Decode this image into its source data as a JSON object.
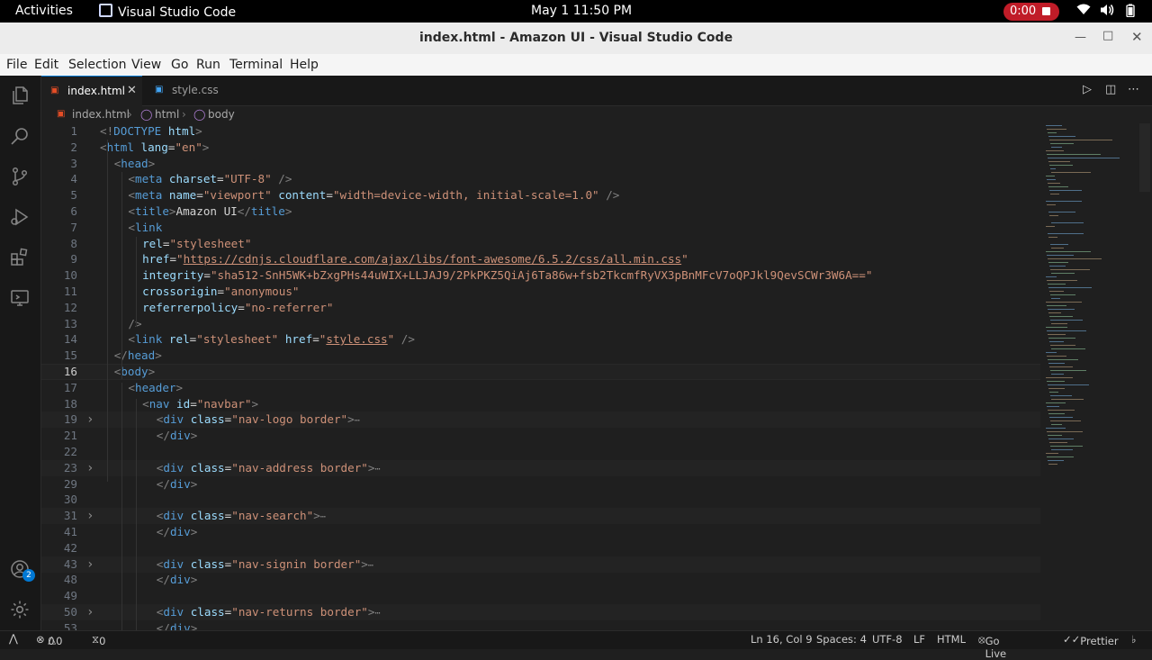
{
  "topbar": {
    "activities": "Activities",
    "app_name": "Visual Studio Code",
    "clock": "May 1  11:50 PM",
    "recording": "0:00"
  },
  "window": {
    "title": "index.html - Amazon UI - Visual Studio Code"
  },
  "menu": [
    "File",
    "Edit",
    "Selection",
    "View",
    "Go",
    "Run",
    "Terminal",
    "Help"
  ],
  "tabs": [
    {
      "label": "index.html",
      "active": true
    },
    {
      "label": "style.css",
      "active": false
    }
  ],
  "breadcrumb": [
    "index.html",
    "html",
    "body"
  ],
  "code_lines": [
    {
      "n": "1",
      "indent": 0,
      "parts": [
        [
          "tg",
          "<!"
        ],
        [
          "tn",
          "DOCTYPE"
        ],
        [
          "at",
          " html"
        ],
        [
          "tg",
          ">"
        ]
      ]
    },
    {
      "n": "2",
      "indent": 0,
      "parts": [
        [
          "tg",
          "<"
        ],
        [
          "tn",
          "html"
        ],
        [
          "at",
          " lang"
        ],
        [
          "tx",
          "="
        ],
        [
          "sv",
          "\"en\""
        ],
        [
          "tg",
          ">"
        ]
      ]
    },
    {
      "n": "3",
      "indent": 2,
      "parts": [
        [
          "tg",
          "<"
        ],
        [
          "tn",
          "head"
        ],
        [
          "tg",
          ">"
        ]
      ]
    },
    {
      "n": "4",
      "indent": 4,
      "parts": [
        [
          "tg",
          "<"
        ],
        [
          "tn",
          "meta"
        ],
        [
          "at",
          " charset"
        ],
        [
          "tx",
          "="
        ],
        [
          "sv",
          "\"UTF-8\""
        ],
        [
          "tg",
          " />"
        ]
      ]
    },
    {
      "n": "5",
      "indent": 4,
      "parts": [
        [
          "tg",
          "<"
        ],
        [
          "tn",
          "meta"
        ],
        [
          "at",
          " name"
        ],
        [
          "tx",
          "="
        ],
        [
          "sv",
          "\"viewport\""
        ],
        [
          "at",
          " content"
        ],
        [
          "tx",
          "="
        ],
        [
          "sv",
          "\"width=device-width, initial-scale=1.0\""
        ],
        [
          "tg",
          " />"
        ]
      ]
    },
    {
      "n": "6",
      "indent": 4,
      "parts": [
        [
          "tg",
          "<"
        ],
        [
          "tn",
          "title"
        ],
        [
          "tg",
          ">"
        ],
        [
          "tx",
          "Amazon UI"
        ],
        [
          "tg",
          "</"
        ],
        [
          "tn",
          "title"
        ],
        [
          "tg",
          ">"
        ]
      ]
    },
    {
      "n": "7",
      "indent": 4,
      "parts": [
        [
          "tg",
          "<"
        ],
        [
          "tn",
          "link"
        ]
      ]
    },
    {
      "n": "8",
      "indent": 6,
      "parts": [
        [
          "at",
          "rel"
        ],
        [
          "tx",
          "="
        ],
        [
          "sv",
          "\"stylesheet\""
        ]
      ]
    },
    {
      "n": "9",
      "indent": 6,
      "parts": [
        [
          "at",
          "href"
        ],
        [
          "tx",
          "="
        ],
        [
          "sv",
          "\""
        ],
        [
          "svu",
          "https://cdnjs.cloudflare.com/ajax/libs/font-awesome/6.5.2/css/all.min.css"
        ],
        [
          "sv",
          "\""
        ]
      ]
    },
    {
      "n": "10",
      "indent": 6,
      "parts": [
        [
          "at",
          "integrity"
        ],
        [
          "tx",
          "="
        ],
        [
          "sv",
          "\"sha512-SnH5WK+bZxgPHs44uWIX+LLJAJ9/2PkPKZ5QiAj6Ta86w+fsb2TkcmfRyVX3pBnMFcV7oQPJkl9QevSCWr3W6A==\""
        ]
      ]
    },
    {
      "n": "11",
      "indent": 6,
      "parts": [
        [
          "at",
          "crossorigin"
        ],
        [
          "tx",
          "="
        ],
        [
          "sv",
          "\"anonymous\""
        ]
      ]
    },
    {
      "n": "12",
      "indent": 6,
      "parts": [
        [
          "at",
          "referrerpolicy"
        ],
        [
          "tx",
          "="
        ],
        [
          "sv",
          "\"no-referrer\""
        ]
      ]
    },
    {
      "n": "13",
      "indent": 4,
      "parts": [
        [
          "tg",
          "/>"
        ]
      ]
    },
    {
      "n": "14",
      "indent": 4,
      "parts": [
        [
          "tg",
          "<"
        ],
        [
          "tn",
          "link"
        ],
        [
          "at",
          " rel"
        ],
        [
          "tx",
          "="
        ],
        [
          "sv",
          "\"stylesheet\""
        ],
        [
          "at",
          " href"
        ],
        [
          "tx",
          "="
        ],
        [
          "sv",
          "\""
        ],
        [
          "svu",
          "style.css"
        ],
        [
          "sv",
          "\""
        ],
        [
          "tg",
          " />"
        ]
      ]
    },
    {
      "n": "15",
      "indent": 2,
      "parts": [
        [
          "tg",
          "</"
        ],
        [
          "tn",
          "head"
        ],
        [
          "tg",
          ">"
        ]
      ]
    },
    {
      "n": "16",
      "indent": 2,
      "parts": [
        [
          "tg",
          "<"
        ],
        [
          "tn",
          "body"
        ],
        [
          "tg",
          ">"
        ]
      ],
      "current": true
    },
    {
      "n": "17",
      "indent": 4,
      "parts": [
        [
          "tg",
          "<"
        ],
        [
          "tn",
          "header"
        ],
        [
          "tg",
          ">"
        ]
      ]
    },
    {
      "n": "18",
      "indent": 6,
      "parts": [
        [
          "tg",
          "<"
        ],
        [
          "tn",
          "nav"
        ],
        [
          "at",
          " id"
        ],
        [
          "tx",
          "="
        ],
        [
          "sv",
          "\"navbar\""
        ],
        [
          "tg",
          ">"
        ]
      ]
    },
    {
      "n": "19",
      "indent": 8,
      "parts": [
        [
          "tg",
          "<"
        ],
        [
          "tn",
          "div"
        ],
        [
          "at",
          " class"
        ],
        [
          "tx",
          "="
        ],
        [
          "sv",
          "\"nav-logo border\""
        ],
        [
          "tg",
          ">"
        ],
        [
          "ell",
          "⋯"
        ]
      ],
      "folded": true
    },
    {
      "n": "21",
      "indent": 8,
      "parts": [
        [
          "tg",
          "</"
        ],
        [
          "tn",
          "div"
        ],
        [
          "tg",
          ">"
        ]
      ]
    },
    {
      "n": "22",
      "indent": 0,
      "parts": []
    },
    {
      "n": "23",
      "indent": 8,
      "parts": [
        [
          "tg",
          "<"
        ],
        [
          "tn",
          "div"
        ],
        [
          "at",
          " class"
        ],
        [
          "tx",
          "="
        ],
        [
          "sv",
          "\"nav-address border\""
        ],
        [
          "tg",
          ">"
        ],
        [
          "ell",
          "⋯"
        ]
      ],
      "folded": true
    },
    {
      "n": "29",
      "indent": 8,
      "parts": [
        [
          "tg",
          "</"
        ],
        [
          "tn",
          "div"
        ],
        [
          "tg",
          ">"
        ]
      ]
    },
    {
      "n": "30",
      "indent": 0,
      "parts": []
    },
    {
      "n": "31",
      "indent": 8,
      "parts": [
        [
          "tg",
          "<"
        ],
        [
          "tn",
          "div"
        ],
        [
          "at",
          " class"
        ],
        [
          "tx",
          "="
        ],
        [
          "sv",
          "\"nav-search\""
        ],
        [
          "tg",
          ">"
        ],
        [
          "ell",
          "⋯"
        ]
      ],
      "folded": true
    },
    {
      "n": "41",
      "indent": 8,
      "parts": [
        [
          "tg",
          "</"
        ],
        [
          "tn",
          "div"
        ],
        [
          "tg",
          ">"
        ]
      ]
    },
    {
      "n": "42",
      "indent": 0,
      "parts": []
    },
    {
      "n": "43",
      "indent": 8,
      "parts": [
        [
          "tg",
          "<"
        ],
        [
          "tn",
          "div"
        ],
        [
          "at",
          " class"
        ],
        [
          "tx",
          "="
        ],
        [
          "sv",
          "\"nav-signin border\""
        ],
        [
          "tg",
          ">"
        ],
        [
          "ell",
          "⋯"
        ]
      ],
      "folded": true
    },
    {
      "n": "48",
      "indent": 8,
      "parts": [
        [
          "tg",
          "</"
        ],
        [
          "tn",
          "div"
        ],
        [
          "tg",
          ">"
        ]
      ]
    },
    {
      "n": "49",
      "indent": 0,
      "parts": []
    },
    {
      "n": "50",
      "indent": 8,
      "parts": [
        [
          "tg",
          "<"
        ],
        [
          "tn",
          "div"
        ],
        [
          "at",
          " class"
        ],
        [
          "tx",
          "="
        ],
        [
          "sv",
          "\"nav-returns border\""
        ],
        [
          "tg",
          ">"
        ],
        [
          "ell",
          "⋯"
        ]
      ],
      "folded": true
    },
    {
      "n": "53",
      "indent": 8,
      "parts": [
        [
          "tg",
          "</"
        ],
        [
          "tn",
          "div"
        ],
        [
          "tg",
          ">"
        ]
      ]
    }
  ],
  "status": {
    "errors": "0",
    "warnings": "0",
    "ports": "0",
    "position": "Ln 16, Col 9",
    "spaces": "Spaces: 4",
    "encoding": "UTF-8",
    "eol": "LF",
    "language": "HTML",
    "golive": "Go Live",
    "prettier": "Prettier"
  },
  "accounts_badge": "2",
  "colors": {
    "accent": "#0078d4",
    "tag": "#569cd6",
    "attr": "#9cdcfe",
    "string": "#ce9178",
    "record": "#c01c28"
  }
}
